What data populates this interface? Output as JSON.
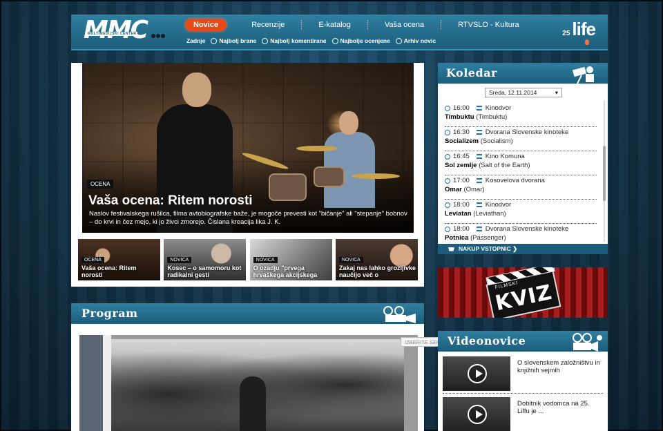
{
  "header": {
    "logo_text": "MMC",
    "logo_sub": "MULTIMEDIJSKI CENTER",
    "nav": [
      {
        "label": "Novice",
        "active": true
      },
      {
        "label": "Recenzije"
      },
      {
        "label": "E-katalog"
      },
      {
        "label": "Vaša ocena"
      },
      {
        "label": "RTVSLO - Kultura"
      }
    ],
    "subnav": [
      "Zadnje",
      "Najbolj brane",
      "Najbolj komentirane",
      "Najbolje ocenjene",
      "Arhiv novic"
    ],
    "life_num": "25",
    "life_word": "life",
    "accent": "#e64a19"
  },
  "feature": {
    "tag": "OCENA",
    "title": "Vaša ocena: Ritem norosti",
    "desc": "Naslov festivalskega rušilca, filma avtobiografske baže, je mogoče prevesti kot \"bičanje\" ali \"stepanje\" bobnov – do krvi in čez mejo, ki jo živci zmorejo. Čislana kreacija lika J. K.",
    "thumbs": [
      {
        "tag": "OCENA",
        "title": "Vaša ocena: Ritem norosti"
      },
      {
        "tag": "NOVICA",
        "title": "Kosec – o samomoru kot radikalni gesti"
      },
      {
        "tag": "NOVICA",
        "title": "O ozadju \"prvega hrvaškega akcijskega"
      },
      {
        "tag": "NOVICA",
        "title": "Zakaj nas lahko grozljivke naučijo več o"
      }
    ]
  },
  "program": {
    "title": "Program",
    "select": "IZBERITE SEKCIJO"
  },
  "koledar": {
    "title": "Koledar",
    "date": "Sreda, 12.11.2014",
    "events": [
      {
        "time": "16:00",
        "venue": "Kinodvor",
        "title": "Timbuktu",
        "orig": "(Timbuktu)"
      },
      {
        "time": "16:30",
        "venue": "Dvorana Slovenske kinoteke",
        "title": "Socializem",
        "orig": "(Socialism)"
      },
      {
        "time": "16:45",
        "venue": "Kino Komuna",
        "title": "Sol zemlje",
        "orig": "(Salt of the Earth)"
      },
      {
        "time": "17:00",
        "venue": "Kosovelova dvorana",
        "title": "Omar",
        "orig": "(Omar)"
      },
      {
        "time": "18:00",
        "venue": "Kinodvor",
        "title": "Leviatan",
        "orig": "(Leviathan)"
      },
      {
        "time": "18:00",
        "venue": "Dvorana Slovenske kinoteke",
        "title": "Potnica",
        "orig": "(Passenger)"
      }
    ],
    "buy": "NAKUP VSTOPNIC ❯"
  },
  "kviz": {
    "label1": "FILMSKI",
    "label2": "KVIZ"
  },
  "videonovice": {
    "title": "Videonovice",
    "items": [
      {
        "text": "O slovenskem založništvu in knjižnih sejmih"
      },
      {
        "text": "Dobitnik vodomca na 25. Liffu je ..."
      }
    ]
  }
}
